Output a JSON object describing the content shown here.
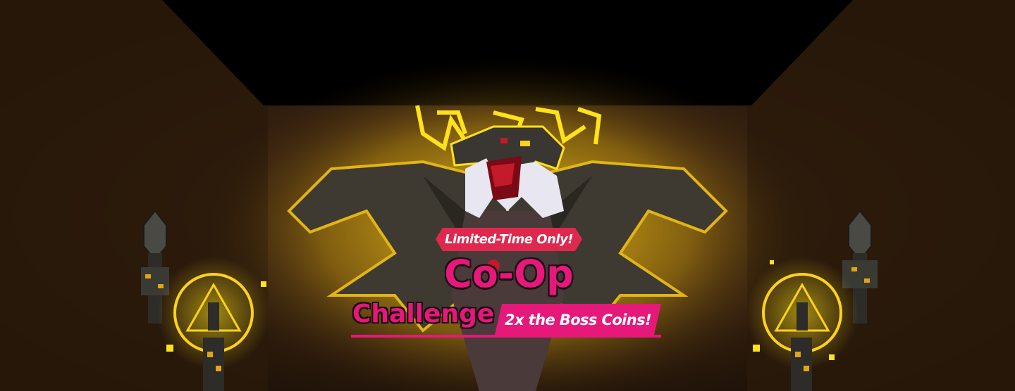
{
  "banner": {
    "badge_label": "Limited-Time Only!",
    "title_line1": "Co-Op",
    "title_line2": "Challenge",
    "promo_label": "2x the Boss Coins!"
  },
  "colors": {
    "accent_pink": "#e6187a",
    "badge_red": "#e0284e",
    "glow_yellow": "#ffe21a",
    "wall_brown": "#3a2410"
  }
}
